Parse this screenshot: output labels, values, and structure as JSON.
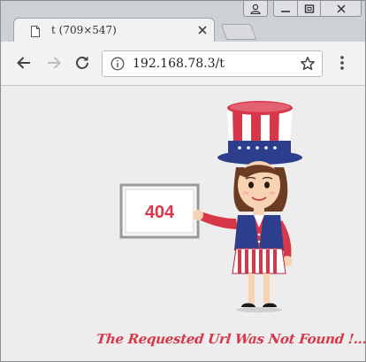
{
  "window": {
    "controls": [
      "user",
      "minimize",
      "maximize",
      "close"
    ]
  },
  "tab": {
    "title": "t (709×547)",
    "close_icon": "close-icon",
    "page_icon": "document-icon"
  },
  "toolbar": {
    "back_icon": "arrow-left-icon",
    "forward_icon": "arrow-right-icon",
    "reload_icon": "reload-icon",
    "menu_icon": "more-vertical-icon"
  },
  "address_bar": {
    "url": "192.168.78.3/t",
    "info_icon": "info-icon",
    "bookmark_icon": "star-icon"
  },
  "page": {
    "sign_text": "404",
    "message": "The Requested Url Was Not Found !...",
    "colors": {
      "accent_red": "#d6384a",
      "navy": "#2d3f8c",
      "background": "#ededed"
    }
  }
}
